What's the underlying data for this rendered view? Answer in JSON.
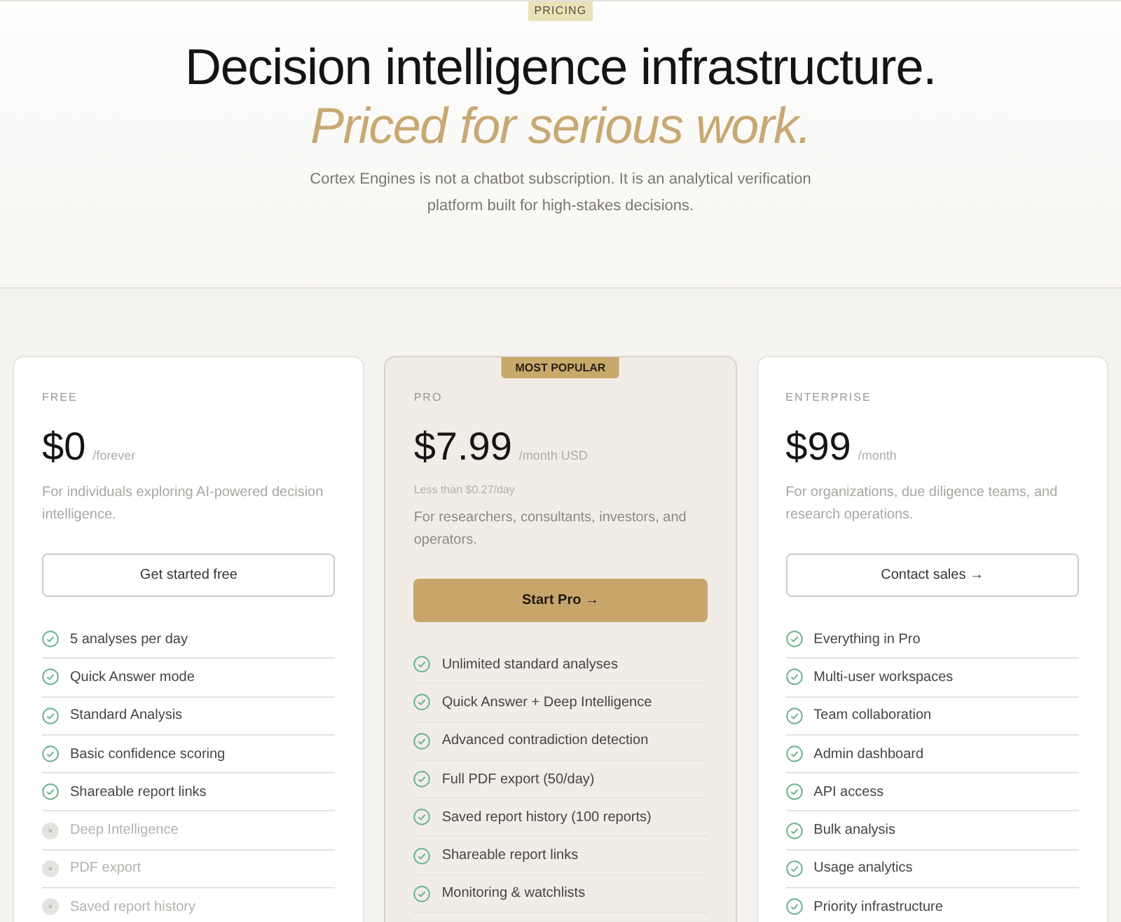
{
  "hero": {
    "eyebrow": "PRICING",
    "title": "Decision intelligence infrastructure.",
    "tagline": "Priced for serious work.",
    "subtitle": "Cortex Engines is not a chatbot subscription. It is an analytical verification platform built for high-stakes decisions."
  },
  "plans": [
    {
      "name": "FREE",
      "featured": false,
      "price": "$0",
      "period": "/forever",
      "description": "For individuals exploring AI-powered decision intelligence.",
      "button": {
        "label": "Get started free",
        "kind": "outline"
      },
      "features": [
        {
          "text": "5 analyses per day",
          "included": true
        },
        {
          "text": "Quick Answer mode",
          "included": true
        },
        {
          "text": "Standard Analysis",
          "included": true
        },
        {
          "text": "Basic confidence scoring",
          "included": true
        },
        {
          "text": "Shareable report links",
          "included": true
        },
        {
          "text": "Deep Intelligence",
          "included": false
        },
        {
          "text": "PDF export",
          "included": false
        },
        {
          "text": "Saved report history",
          "included": false
        }
      ]
    },
    {
      "name": "PRO",
      "featured": true,
      "badge": "MOST POPULAR",
      "price": "$7.99",
      "period": "/month USD",
      "note": "Less than $0.27/day",
      "description": "For researchers, consultants, investors, and operators.",
      "button": {
        "label": "Start Pro →",
        "kind": "filled"
      },
      "features": [
        {
          "text": "Unlimited standard analyses",
          "included": true
        },
        {
          "text": "Quick Answer + Deep Intelligence",
          "included": true
        },
        {
          "text": "Advanced contradiction detection",
          "included": true
        },
        {
          "text": "Full PDF export (50/day)",
          "included": true
        },
        {
          "text": "Saved report history (100 reports)",
          "included": true
        },
        {
          "text": "Shareable report links",
          "included": true
        },
        {
          "text": "Monitoring & watchlists",
          "included": true
        }
      ]
    },
    {
      "name": "ENTERPRISE",
      "featured": false,
      "price": "$99",
      "period": "/month",
      "description": "For organizations, due diligence teams, and research operations.",
      "button": {
        "label": "Contact sales →",
        "kind": "outline"
      },
      "features": [
        {
          "text": "Everything in Pro",
          "included": true
        },
        {
          "text": "Multi-user workspaces",
          "included": true
        },
        {
          "text": "Team collaboration",
          "included": true
        },
        {
          "text": "Admin dashboard",
          "included": true
        },
        {
          "text": "API access",
          "included": true
        },
        {
          "text": "Bulk analysis",
          "included": true
        },
        {
          "text": "Usage analytics",
          "included": true
        },
        {
          "text": "Priority infrastructure",
          "included": true
        }
      ]
    }
  ]
}
